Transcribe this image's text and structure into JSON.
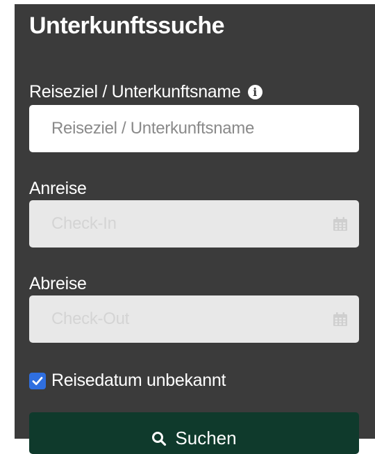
{
  "panel": {
    "title": "Unterkunftssuche"
  },
  "destination": {
    "label": "Reiseziel / Unterkunftsname",
    "info_icon": "info-icon",
    "placeholder": "Reiseziel / Unterkunftsname",
    "value": ""
  },
  "arrival": {
    "label": "Anreise",
    "placeholder": "Check-In",
    "icon": "calendar-icon"
  },
  "departure": {
    "label": "Abreise",
    "placeholder": "Check-Out",
    "icon": "calendar-icon"
  },
  "unknown_date": {
    "label": "Reisedatum unbekannt",
    "checked": true
  },
  "search_button": {
    "label": "Suchen",
    "icon": "search-icon"
  },
  "colors": {
    "panel_background": "#3b3b3b",
    "button_background": "#0f3a2c",
    "checkbox_accent": "#2f6fe0",
    "disabled_field": "#e8e8e8"
  }
}
